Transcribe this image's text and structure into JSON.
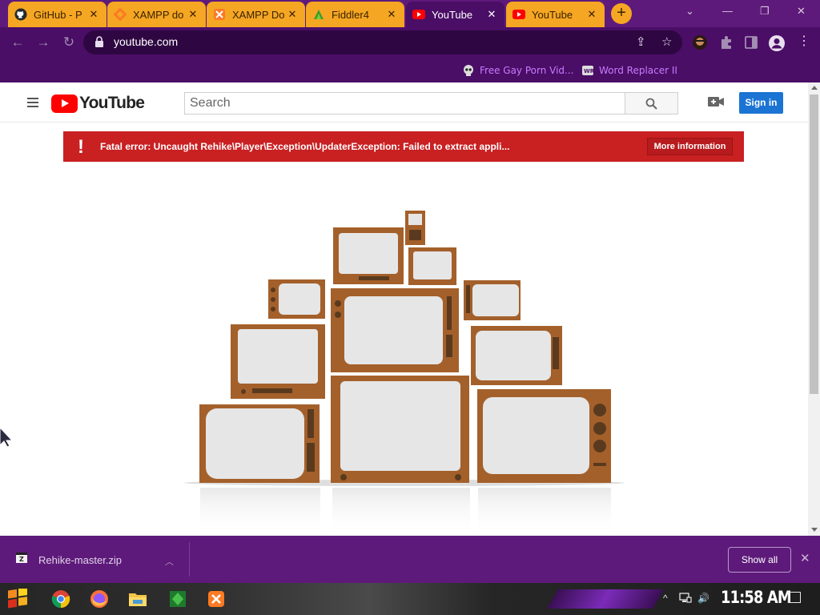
{
  "browser": {
    "tabs": [
      {
        "title": "GitHub - P",
        "icon": "github-icon",
        "active": false
      },
      {
        "title": "XAMPP do",
        "icon": "xampp-icon",
        "active": false
      },
      {
        "title": "XAMPP Do",
        "icon": "xampp-icon",
        "active": false
      },
      {
        "title": "Fiddler4",
        "icon": "fiddler-icon",
        "active": false
      },
      {
        "title": "YouTube",
        "icon": "youtube-icon",
        "active": true
      },
      {
        "title": "YouTube",
        "icon": "youtube-icon",
        "active": false
      }
    ],
    "tab_close_glyph": "✕",
    "new_tab_glyph": "+",
    "window_controls": {
      "minimize": "—",
      "restore": "❐",
      "close": "✕",
      "dropdown": "⌄"
    },
    "nav": {
      "back": "←",
      "forward": "→",
      "reload": "↻"
    },
    "address": "youtube.com",
    "address_icons": {
      "share": "⇪",
      "star": "☆"
    },
    "bookmarks": [
      {
        "label": "Free Gay Porn Vid...",
        "icon": "skull-icon"
      },
      {
        "label": "Word Replacer II",
        "icon": "word-replacer-icon"
      }
    ],
    "colors": {
      "tab_accent": "#f5a623",
      "chrome_purple": "#4a0e66",
      "bookmark_text": "#c97bff"
    }
  },
  "youtube": {
    "logo_text": "YouTube",
    "search_placeholder": "Search",
    "signin_label": "Sign in",
    "error_message": "Fatal error: Uncaught Rehike\\Player\\Exception\\UpdaterException: Failed to extract appli...",
    "error_button": "More information",
    "error_glyph": "!",
    "colors": {
      "logo_red": "#ff0000",
      "error_red": "#c92022",
      "signin_blue": "#1b74d3"
    }
  },
  "downloads": {
    "file_name": "Rehike-master.zip",
    "chevron": "︿",
    "show_all_label": "Show all",
    "close_glyph": "✕"
  },
  "taskbar": {
    "apps": [
      "start-icon",
      "chrome-icon",
      "firefox-icon",
      "file-explorer-icon",
      "fiddler-icon",
      "xampp-icon"
    ],
    "tray": {
      "chevron": "^",
      "volume": "🔊"
    },
    "clock": "11:58 AM"
  }
}
